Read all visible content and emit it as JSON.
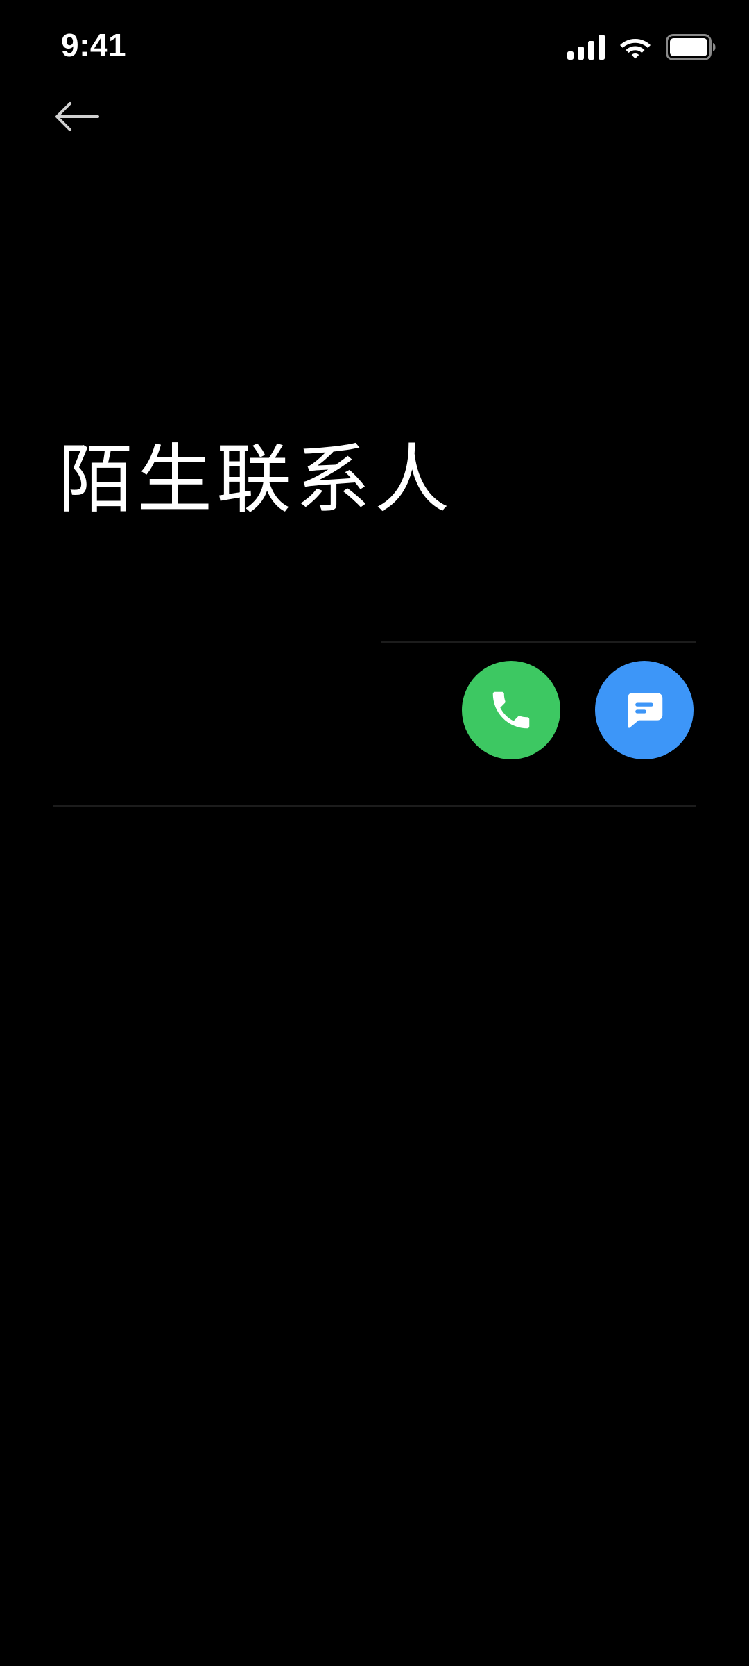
{
  "status_bar": {
    "time": "9:41",
    "signal_icon": "cellular-signal-icon",
    "wifi_icon": "wifi-icon",
    "battery_icon": "battery-icon"
  },
  "header": {
    "back_icon": "arrow-left-icon"
  },
  "contact": {
    "title": "陌生联系人"
  },
  "actions": {
    "call": {
      "icon": "phone-icon",
      "color": "#3DC862"
    },
    "message": {
      "icon": "message-icon",
      "color": "#3D96F8"
    }
  }
}
